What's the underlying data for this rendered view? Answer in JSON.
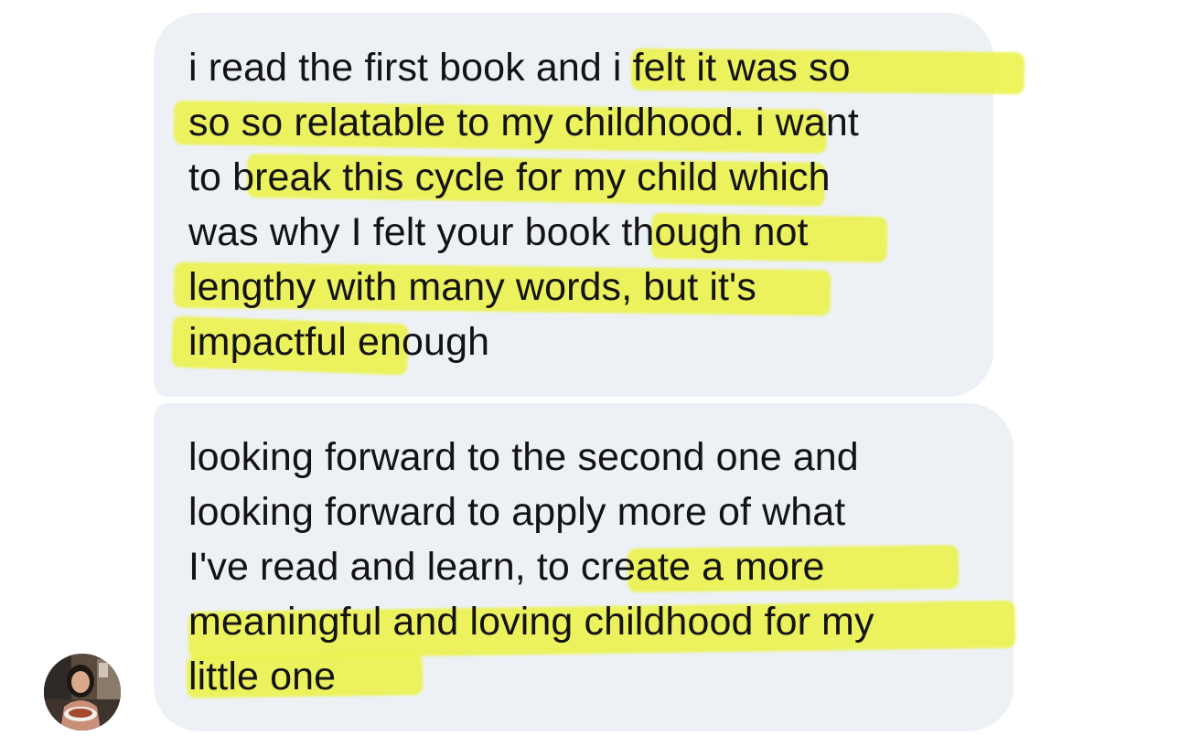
{
  "messages": [
    {
      "lines": [
        "i read the first book and i felt it was so",
        "so so relatable to my childhood. i want",
        "to break this cycle for my child which",
        "was why I felt your book though not",
        "lengthy with many words, but it's",
        "impactful enough"
      ]
    },
    {
      "lines": [
        "looking forward to the second one and",
        "looking forward to apply more of what",
        "I've read and learn, to create a more",
        "meaningful and loving childhood for my",
        "little one"
      ]
    }
  ],
  "colors": {
    "bubble": "#edf1f5",
    "highlight": "#eaf248",
    "text": "#131313"
  }
}
